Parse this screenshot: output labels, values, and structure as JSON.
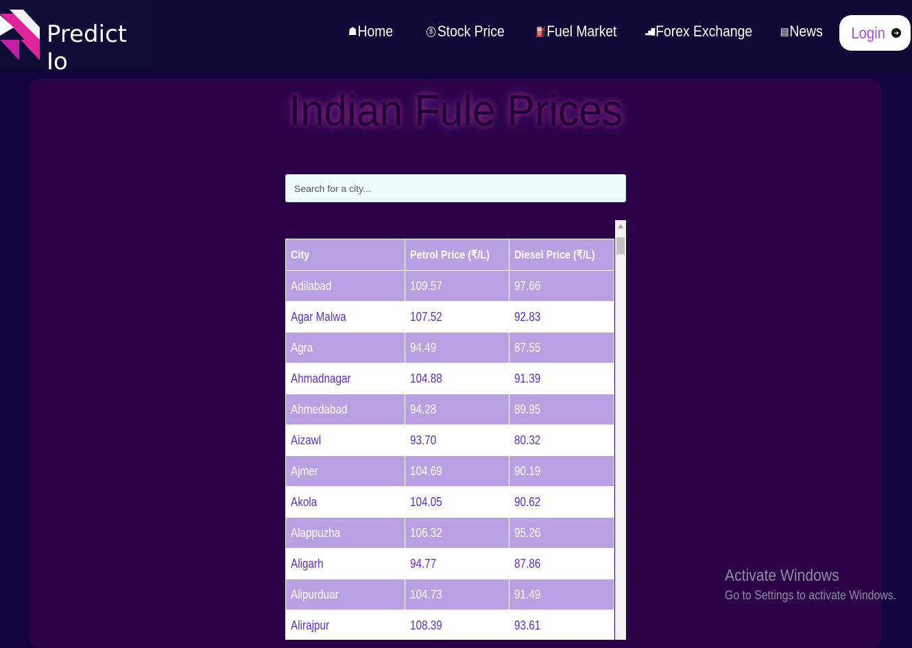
{
  "brand": {
    "name": "Predict Io"
  },
  "nav": {
    "items": [
      {
        "icon": "home-icon",
        "glyph": "☗",
        "label": "Home"
      },
      {
        "icon": "dollar-coin-icon",
        "glyph": "$",
        "label": "Stock Price"
      },
      {
        "icon": "fuel-pump-icon",
        "glyph": "⛽",
        "label": "Fuel Market"
      },
      {
        "icon": "bar-chart-icon",
        "glyph": "▂▅█",
        "label": "Forex Exchange"
      },
      {
        "icon": "newspaper-icon",
        "glyph": "▤",
        "label": "News"
      }
    ],
    "login_label": "Login"
  },
  "page": {
    "title": "Indian Fule Prices"
  },
  "search": {
    "placeholder": "Search for a city..."
  },
  "table": {
    "headers": [
      "City",
      "Petrol Price (₹/L)",
      "Diesel Price (₹/L)"
    ],
    "rows": [
      [
        "Adilabad",
        "109.57",
        "97.66"
      ],
      [
        "Agar Malwa",
        "107.52",
        "92.83"
      ],
      [
        "Agra",
        "94.49",
        "87.55"
      ],
      [
        "Ahmadnagar",
        "104.88",
        "91.39"
      ],
      [
        "Ahmedabad",
        "94.28",
        "89.95"
      ],
      [
        "Aizawl",
        "93.70",
        "80.32"
      ],
      [
        "Ajmer",
        "104.69",
        "90.19"
      ],
      [
        "Akola",
        "104.05",
        "90.62"
      ],
      [
        "Alappuzha",
        "106.32",
        "95.26"
      ],
      [
        "Aligarh",
        "94.77",
        "87.86"
      ],
      [
        "Alipurduar",
        "104.73",
        "91.49"
      ],
      [
        "Alirajpur",
        "108.39",
        "93.61"
      ]
    ]
  },
  "watermark": {
    "line1": "Activate Windows",
    "line2": "Go to Settings to activate Windows."
  },
  "colors": {
    "navbar": "#0f0b36",
    "panel": "#2d0347",
    "row_accent": "#b8a0e3",
    "link_text": "#5d2ed1",
    "login_text": "#a64ddc"
  }
}
